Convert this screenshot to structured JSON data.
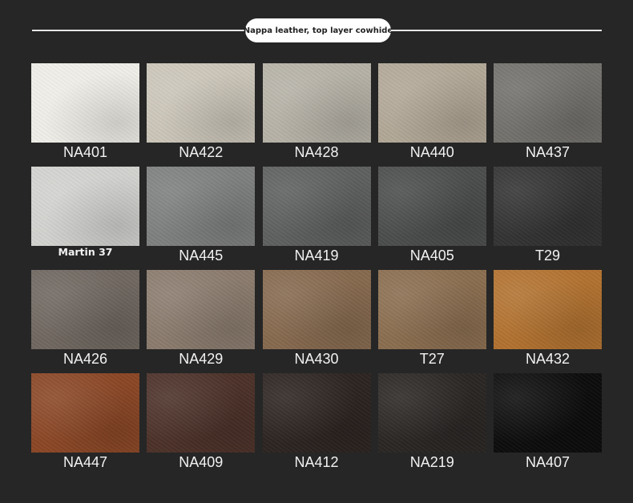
{
  "header": {
    "title": "Nappa leather, top layer cowhide"
  },
  "swatches": [
    {
      "code": "NA401",
      "color": "#efede7"
    },
    {
      "code": "NA422",
      "color": "#cbc5b9"
    },
    {
      "code": "NA428",
      "color": "#b6b2a7"
    },
    {
      "code": "NA440",
      "color": "#b2a797"
    },
    {
      "code": "NA437",
      "color": "#73716c"
    },
    {
      "code": "Martin 37",
      "color": "#d2d2cf"
    },
    {
      "code": "NA445",
      "color": "#7e7f7f"
    },
    {
      "code": "NA419",
      "color": "#5e5f5f"
    },
    {
      "code": "NA405",
      "color": "#4b4c4c"
    },
    {
      "code": "T29",
      "color": "#333333"
    },
    {
      "code": "NA426",
      "color": "#6f6760"
    },
    {
      "code": "NA429",
      "color": "#8a7b6d"
    },
    {
      "code": "NA430",
      "color": "#86694e"
    },
    {
      "code": "T27",
      "color": "#8a6d4f"
    },
    {
      "code": "NA432",
      "color": "#b2722f"
    },
    {
      "code": "NA447",
      "color": "#8a4625"
    },
    {
      "code": "NA409",
      "color": "#4b3128"
    },
    {
      "code": "NA412",
      "color": "#2c2421"
    },
    {
      "code": "NA219",
      "color": "#2a2624"
    },
    {
      "code": "NA407",
      "color": "#0c0c0c"
    }
  ]
}
